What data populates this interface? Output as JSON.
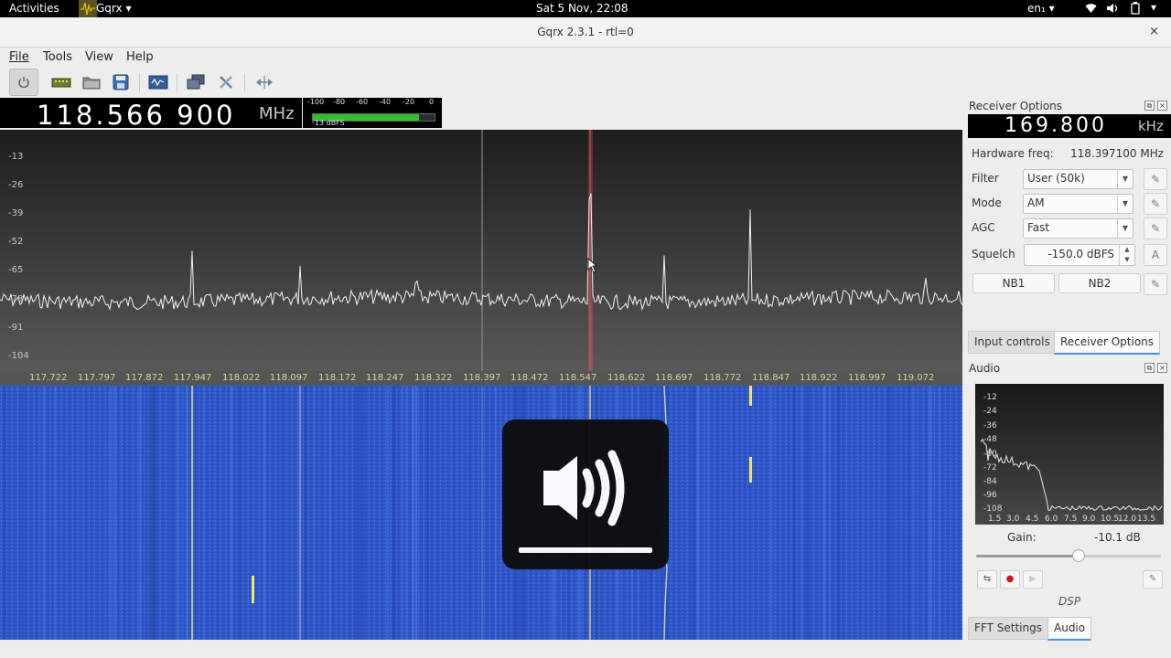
{
  "topbar": {
    "activities": "Activities",
    "app_menu": "Gqrx",
    "app_menu_arrow": "▾",
    "clock": "Sat  5 Nov, 22:08",
    "lang": "en₁",
    "lang_arrow": "▾",
    "status_icons": [
      "wifi-icon",
      "volume-icon",
      "battery-icon"
    ]
  },
  "window": {
    "title": "Gqrx 2.3.1 - rtl=0",
    "close": "×"
  },
  "menu": [
    "File",
    "Tools",
    "View",
    "Help"
  ],
  "toolbar": {
    "buttons": [
      "power-icon",
      "hardware-icon",
      "open-icon",
      "save-icon",
      "screenshot-icon",
      "configure-device-icon",
      "settings-icon",
      "fullscreen-icon"
    ]
  },
  "frequency": {
    "value": "118.566 900",
    "unit": "MHz"
  },
  "meter": {
    "scale": [
      "-100",
      "-80",
      "-60",
      "-40",
      "-20",
      "0"
    ],
    "level_fraction": 0.87,
    "label": "-13 dBFS"
  },
  "spectrum": {
    "y_ticks": [
      "-13",
      "-26",
      "-39",
      "-52",
      "-65",
      "-78",
      "-91",
      "-104"
    ],
    "x_ticks": [
      "117.722",
      "117.797",
      "117.872",
      "117.947",
      "118.022",
      "118.097",
      "118.172",
      "118.247",
      "118.322",
      "118.397",
      "118.472",
      "118.547",
      "118.622",
      "118.697",
      "118.772",
      "118.847",
      "118.922",
      "118.997",
      "119.072"
    ]
  },
  "receiver_options": {
    "title": "Receiver Options",
    "offset_value": "169.800",
    "offset_unit": "kHz",
    "hw_freq_label": "Hardware freq:",
    "hw_freq_value": "118.397100 MHz",
    "filter_label": "Filter",
    "filter_value": "User (50k)",
    "mode_label": "Mode",
    "mode_value": "AM",
    "agc_label": "AGC",
    "agc_value": "Fast",
    "squelch_label": "Squelch",
    "squelch_value": "-150.0 dBFS",
    "squelch_auto": "A",
    "nb1": "NB1",
    "nb2": "NB2"
  },
  "tabs_top": [
    "Input controls",
    "Receiver Options"
  ],
  "audio": {
    "title": "Audio",
    "y_ticks": [
      "-12",
      "-24",
      "-36",
      "-48",
      "-60",
      "-72",
      "-84",
      "-96",
      "-108"
    ],
    "x_ticks": [
      "1.5",
      "3.0",
      "4.5",
      "6.0",
      "7.5",
      "9.0",
      "10.5",
      "12.0",
      "13.5"
    ],
    "gain_label": "Gain:",
    "gain_value": "-10.1 dB",
    "gain_fraction": 0.55,
    "dsp_label": "DSP"
  },
  "tabs_bottom": [
    "FFT Settings",
    "Audio"
  ]
}
